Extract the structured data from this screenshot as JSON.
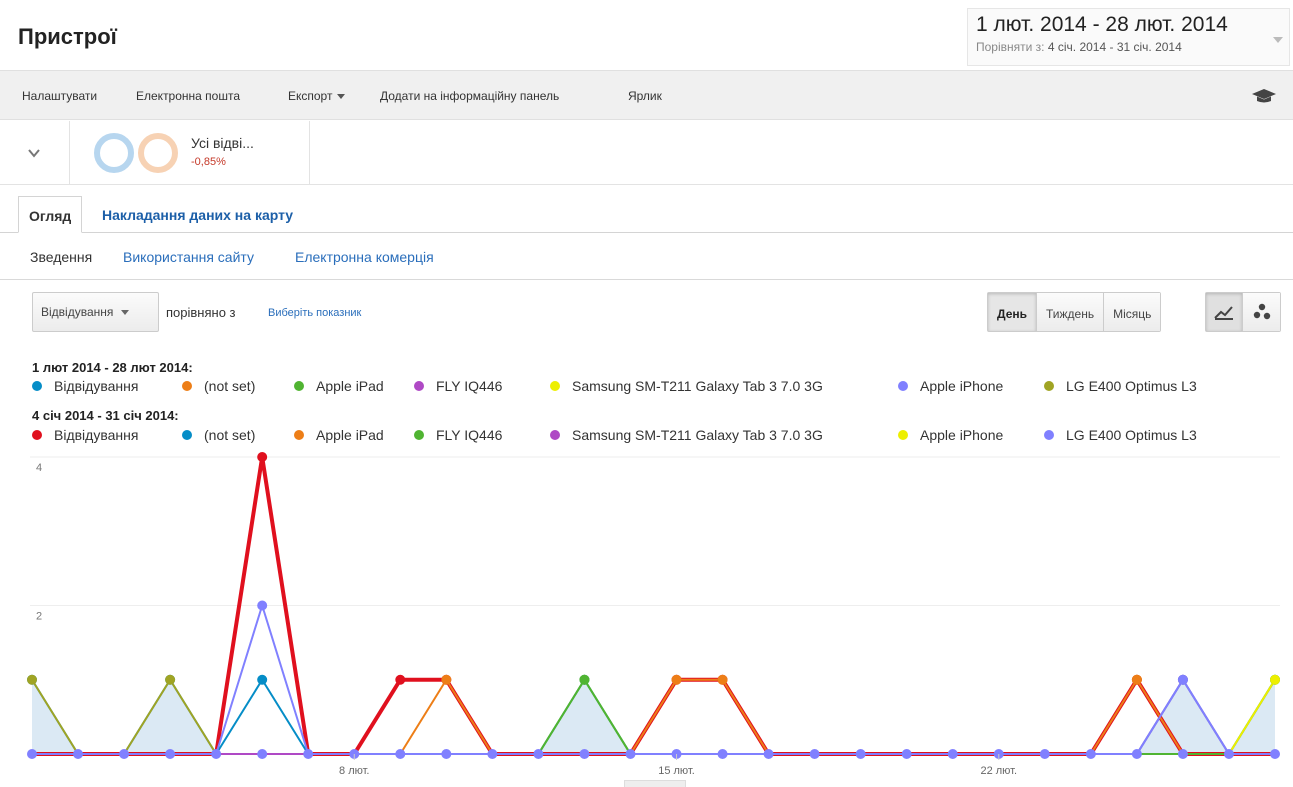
{
  "header": {
    "title": "Пристрої",
    "date_range": "1 лют. 2014 - 28 лют. 2014",
    "compare_label": "Порівняти з:",
    "compare_range": "4 січ. 2014 - 31 січ. 2014"
  },
  "toolbar": {
    "items": [
      "Налаштувати",
      "Електронна пошта",
      "Експорт",
      "Додати на інформаційну панель",
      "Ярлик"
    ],
    "icon": "graduation-cap-icon"
  },
  "segment": {
    "name": "Усі відві...",
    "delta": "-0,85%"
  },
  "tabs": {
    "active": "Огляд",
    "other": "Накладання даних на карту"
  },
  "subtabs": [
    "Зведення",
    "Використання сайту",
    "Електронна комерція"
  ],
  "controls": {
    "metric": "Відвідування",
    "compare_text": "порівняно з",
    "choose_metric": "Виберіть показник",
    "periods": [
      "День",
      "Тиждень",
      "Місяць"
    ],
    "selected_period": "День",
    "view_icons": [
      "line-chart-icon",
      "motion-chart-icon"
    ]
  },
  "legend": {
    "current_title": "1 лют 2014 - 28 лют 2014:",
    "previous_title": "4 січ 2014 - 31 січ 2014:",
    "current": [
      {
        "label": "Відвідування",
        "color": "#058dc7"
      },
      {
        "label": "(not set)",
        "color": "#ed7e17"
      },
      {
        "label": "Apple iPad",
        "color": "#50b432"
      },
      {
        "label": "FLY IQ446",
        "color": "#af49c5"
      },
      {
        "label": "Samsung SM-T211 Galaxy Tab 3 7.0 3G",
        "color": "#edef00"
      },
      {
        "label": "Apple iPhone",
        "color": "#8080ff"
      },
      {
        "label": "LG E400 Optimus L3",
        "color": "#a0a424"
      }
    ],
    "previous": [
      {
        "label": "Відвідування",
        "color": "#e0101e"
      },
      {
        "label": "(not set)",
        "color": "#058dc7"
      },
      {
        "label": "Apple iPad",
        "color": "#ed7e17"
      },
      {
        "label": "FLY IQ446",
        "color": "#50b432"
      },
      {
        "label": "Samsung SM-T211 Galaxy Tab 3 7.0 3G",
        "color": "#af49c5"
      },
      {
        "label": "Apple iPhone",
        "color": "#edef00"
      },
      {
        "label": "LG E400 Optimus L3",
        "color": "#8080ff"
      }
    ]
  },
  "chart_data": {
    "type": "line",
    "x": [
      1,
      2,
      3,
      4,
      5,
      6,
      7,
      8,
      9,
      10,
      11,
      12,
      13,
      14,
      15,
      16,
      17,
      18,
      19,
      20,
      21,
      22,
      23,
      24,
      25,
      26,
      27,
      28
    ],
    "x_tick_labels": [
      "8 лют.",
      "15 лют.",
      "22 лют."
    ],
    "x_tick_positions": [
      8,
      15,
      22
    ],
    "y_tick_labels": [
      "2",
      "4"
    ],
    "ylim": [
      0,
      4
    ],
    "series": [
      {
        "name": "Відвідування",
        "period": "1 лют 2014 - 28 лют 2014",
        "color": "#058dc7",
        "area": true,
        "values": [
          1,
          0,
          0,
          1,
          0,
          0,
          0,
          0,
          0,
          0,
          0,
          0,
          1,
          0,
          0,
          0,
          0,
          0,
          0,
          0,
          0,
          0,
          0,
          0,
          0,
          1,
          0,
          1
        ]
      },
      {
        "name": "Apple iPad",
        "period": "1 лют 2014 - 28 лют 2014",
        "color": "#50b432",
        "values": [
          0,
          0,
          0,
          0,
          0,
          0,
          0,
          0,
          0,
          0,
          0,
          0,
          1,
          0,
          0,
          0,
          0,
          0,
          0,
          0,
          0,
          0,
          0,
          0,
          0,
          0,
          0,
          1
        ]
      },
      {
        "name": "LG E400 Optimus L3",
        "period": "1 лют 2014 - 28 лют 2014",
        "color": "#a0a424",
        "values": [
          1,
          0,
          0,
          1,
          0,
          0,
          0,
          0,
          0,
          0,
          0,
          0,
          0,
          0,
          0,
          0,
          0,
          0,
          0,
          0,
          0,
          0,
          0,
          0,
          0,
          0,
          0,
          0
        ]
      },
      {
        "name": "Samsung SM-T211 Galaxy Tab 3 7.0 3G",
        "period": "1 лют 2014 - 28 лют 2014",
        "color": "#edef00",
        "values": [
          0,
          0,
          0,
          0,
          0,
          0,
          0,
          0,
          0,
          0,
          0,
          0,
          0,
          0,
          0,
          0,
          0,
          0,
          0,
          0,
          0,
          0,
          0,
          0,
          1,
          0,
          0,
          1
        ]
      },
      {
        "name": "Відвідування",
        "period": "4 січ 2014 - 31 січ 2014",
        "color": "#e0101e",
        "values": [
          0,
          0,
          0,
          0,
          0,
          4,
          0,
          0,
          1,
          1,
          0,
          0,
          0,
          0,
          1,
          1,
          0,
          0,
          0,
          0,
          0,
          0,
          0,
          0,
          1,
          0,
          0,
          0
        ]
      },
      {
        "name": "(not set)",
        "period": "4 січ 2014 - 31 січ 2014",
        "color": "#058dc7",
        "values": [
          0,
          0,
          0,
          0,
          0,
          1,
          0,
          0,
          0,
          0,
          0,
          0,
          0,
          0,
          0,
          0,
          0,
          0,
          0,
          0,
          0,
          0,
          0,
          0,
          0,
          0,
          0,
          0
        ]
      },
      {
        "name": "Apple iPad",
        "period": "4 січ 2014 - 31 січ 2014",
        "color": "#ed7e17",
        "values": [
          0,
          0,
          0,
          0,
          0,
          0,
          0,
          0,
          0,
          1,
          0,
          0,
          0,
          0,
          1,
          1,
          0,
          0,
          0,
          0,
          0,
          0,
          0,
          0,
          1,
          0,
          0,
          0
        ]
      },
      {
        "name": "FLY IQ446",
        "period": "4 січ 2014 - 31 січ 2014",
        "color": "#50b432",
        "values": [
          0,
          0,
          0,
          0,
          0,
          0,
          0,
          0,
          0,
          0,
          0,
          0,
          1,
          0,
          0,
          0,
          0,
          0,
          0,
          0,
          0,
          0,
          0,
          0,
          0,
          0,
          0,
          0
        ]
      },
      {
        "name": "Samsung SM-T211 Galaxy Tab 3 7.0 3G",
        "period": "4 січ 2014 - 31 січ 2014",
        "color": "#af49c5",
        "values": [
          0,
          0,
          0,
          0,
          0,
          0,
          0,
          0,
          0,
          0,
          0,
          0,
          0,
          0,
          0,
          0,
          0,
          0,
          0,
          0,
          0,
          0,
          0,
          0,
          0,
          1,
          0,
          0
        ]
      },
      {
        "name": "LG E400 Optimus L3",
        "period": "4 січ 2014 - 31 січ 2014",
        "color": "#8080ff",
        "values": [
          0,
          0,
          0,
          0,
          0,
          2,
          0,
          0,
          0,
          0,
          0,
          0,
          0,
          0,
          0,
          0,
          0,
          0,
          0,
          0,
          0,
          0,
          0,
          0,
          0,
          1,
          0,
          0
        ]
      }
    ]
  }
}
